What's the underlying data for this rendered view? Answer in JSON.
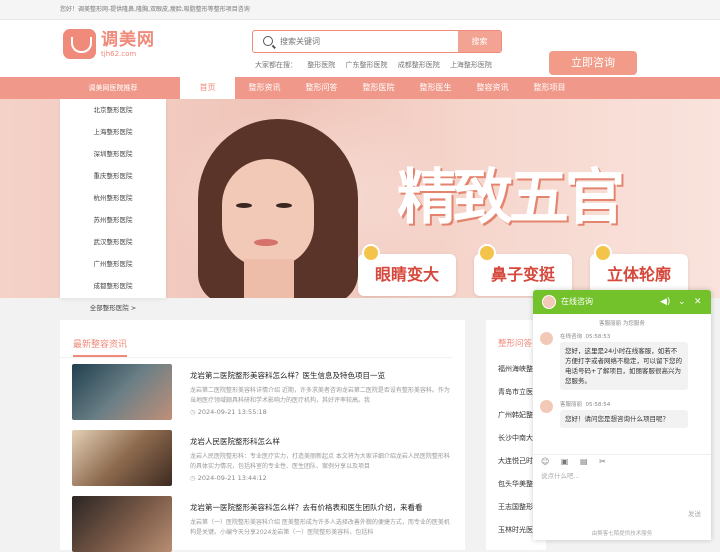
{
  "topbar": {
    "text": "您好！调美整形网-提供隆鼻,隆胸,双眼皮,瘦脸,吸脂整形等整形项目咨询"
  },
  "logo": {
    "name": "调美网",
    "domain": "tjh62.com"
  },
  "search": {
    "placeholder": "搜索关键词",
    "button": "搜索"
  },
  "hot": {
    "label": "大家都在搜：",
    "items": [
      "整形医院",
      "广东整形医院",
      "成都整形医院",
      "上海整形医院"
    ]
  },
  "consult_button": "立即咨询",
  "nav": {
    "category": "调美网医院推荐",
    "items": [
      "首页",
      "整形资讯",
      "整形问答",
      "整形医院",
      "整形医生",
      "整容资讯",
      "整形项目"
    ],
    "active_index": 0
  },
  "sidebar": {
    "items": [
      "北京整形医院",
      "上海整形医院",
      "深圳整形医院",
      "重庆整形医院",
      "杭州整形医院",
      "苏州整形医院",
      "武汉整形医院",
      "广州整形医院",
      "成都整形医院",
      "全部整形医院  >"
    ]
  },
  "banner": {
    "title": "精致五官",
    "cards": [
      "眼睛变大",
      "鼻子变挺",
      "立体轮廓"
    ]
  },
  "latest": {
    "title": "最新整容资讯",
    "articles": [
      {
        "title": "龙岩第二医院整形美容科怎么样？医生信息及特色项目一览",
        "desc": "龙岩第二医院整形美容科详情介绍 近期，许多求美者咨询龙岩第二医院是否设有整形美容科。作为当地医疗领域颇具科研和学术影响力的医疗机构，其好评率较高。我",
        "time": "2024-09-21 13:55:18"
      },
      {
        "title": "龙岩人民医院整形科怎么样",
        "desc": "龙岩人民医院整形科：专业医疗实力，打造美丽新起点 本文将为大家详细介绍龙岩人民医院整形科的具体实力情况，包括科室的专业性、医生团队、案例分享以及项目",
        "time": "2024-09-21 13:44:12"
      },
      {
        "title": "龙岩第一医院整形美容科怎么样？去有价格表和医生团队介绍，来看看",
        "desc": "龙岩第（一）医院整形美容科介绍 医美整形成为许多人选择改善外貌的便捷方式，而专业的医美机构是关键。小编今天分享2024龙岩第（一）医院整形美容科，包括科",
        "time": ""
      }
    ]
  },
  "right_box": {
    "title": "整形问答",
    "items": [
      "福州海峡整",
      "青岛市立医",
      "广州韩妃整",
      "长沙中南大",
      "大连悦己时",
      "包头华美整",
      "王志国整形",
      "玉林时光医"
    ]
  },
  "chat": {
    "title": "在线咨询",
    "system_notice": "客服丽丽 为您服务",
    "messages": [
      {
        "sender": "在线咨询",
        "time": "05:58:53",
        "text": "您好，这里是24小时在线客服，如若不方便打字或者网络不稳定，可以留下您的电话号码+了解项目，如丽客服很高兴为您服务。"
      },
      {
        "sender": "客服丽丽",
        "time": "05:58:54",
        "text": "您好！请问您是想咨询什么项目呢？"
      }
    ],
    "input_placeholder": "说点什么吧...",
    "send": "发送",
    "footer": "由獒客七陌提供技术服务"
  },
  "colors": {
    "brand": "#f08a7a",
    "nav": "#f0998a",
    "chat_green": "#73c12b"
  }
}
